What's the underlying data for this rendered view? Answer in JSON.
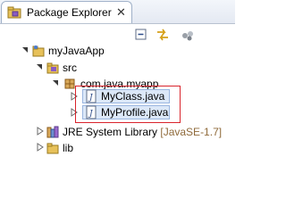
{
  "tab": {
    "title": "Package Explorer",
    "close": "✕"
  },
  "toolbar": {
    "icons": [
      "collapse-all-icon",
      "link-with-editor-icon",
      "view-menu-icon"
    ]
  },
  "tree": {
    "project": {
      "label": "myJavaApp"
    },
    "src": {
      "label": "src"
    },
    "package": {
      "label": "com.java.myapp"
    },
    "files": [
      {
        "label": "MyClass.java"
      },
      {
        "label": "MyProfile.java"
      }
    ],
    "jre": {
      "label": "JRE System Library",
      "qualifier": "[JavaSE-1.7]"
    },
    "lib": {
      "label": "lib"
    }
  },
  "colors": {
    "highlight_box": "#d9242c",
    "selection": "#dce8f8"
  }
}
